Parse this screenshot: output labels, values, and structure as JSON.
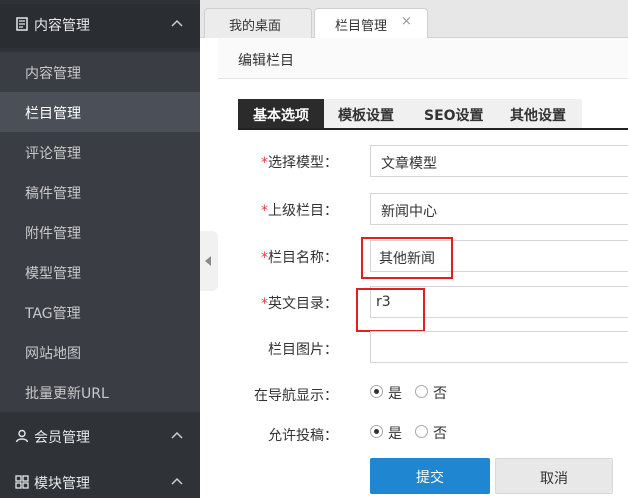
{
  "sidebar": {
    "group_content": {
      "label": "内容管理",
      "icon": "document-icon"
    },
    "items": [
      {
        "label": "内容管理"
      },
      {
        "label": "栏目管理"
      },
      {
        "label": "评论管理"
      },
      {
        "label": "稿件管理"
      },
      {
        "label": "附件管理"
      },
      {
        "label": "模型管理"
      },
      {
        "label": "TAG管理"
      },
      {
        "label": "网站地图"
      },
      {
        "label": "批量更新URL"
      }
    ],
    "group_member": {
      "label": "会员管理",
      "icon": "user-icon"
    },
    "group_module": {
      "label": "模块管理",
      "icon": "grid-icon"
    }
  },
  "tabs": {
    "desktop": "我的桌面",
    "column_manage": "栏目管理",
    "close_glyph": "×"
  },
  "panel": {
    "title": "编辑栏目"
  },
  "form_tabs": [
    "基本选项",
    "模板设置",
    "SEO设置",
    "其他设置"
  ],
  "form": {
    "required_mark": "*",
    "model": {
      "label": "选择模型：",
      "value": "文章模型"
    },
    "parent": {
      "label": "上级栏目：",
      "value": "新闻中心"
    },
    "name": {
      "label": "栏目名称：",
      "value": "其他新闻"
    },
    "dir": {
      "label": "英文目录：",
      "value": "r3"
    },
    "image": {
      "label": "栏目图片："
    },
    "nav_show": {
      "label": "在导航显示：",
      "yes": "是",
      "no": "否",
      "selected": "是"
    },
    "allow_submit": {
      "label": "允许投稿：",
      "yes": "是",
      "no": "否",
      "selected": "是"
    },
    "submit_label": "提交",
    "cancel_label": "取消"
  }
}
